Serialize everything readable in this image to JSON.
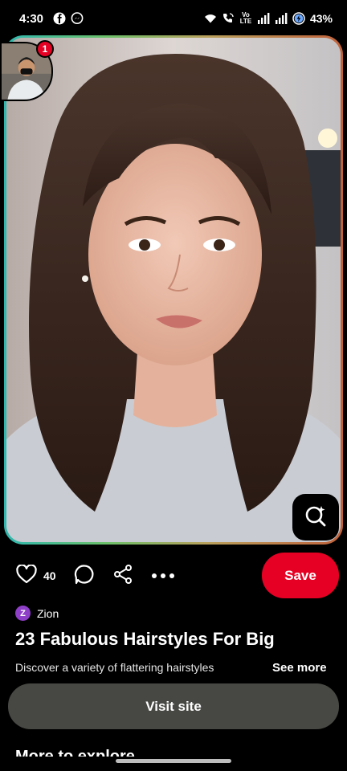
{
  "status_bar": {
    "time": "4:30",
    "left_icons": [
      "facebook-icon",
      "messenger-icon"
    ],
    "right_icons": [
      "wifi-icon",
      "wifi-call-icon",
      "volte-icon",
      "signal-icon",
      "signal-icon",
      "battery-saver-icon"
    ],
    "volte_label": "Vo\nLTE",
    "battery": "43%"
  },
  "profile": {
    "notification_count": "1"
  },
  "pin": {
    "like_count": "40",
    "save_label": "Save",
    "creator_initial": "Z",
    "creator_name": "Zion",
    "title": "23 Fabulous Hairstyles For Big",
    "description": "Discover a variety of flattering hairstyles",
    "see_more_label": "See more",
    "visit_label": "Visit site",
    "more_heading": "More to explore"
  },
  "colors": {
    "save": "#e60023",
    "visit": "#474743",
    "creator_badge": "#8e3fc7",
    "background": "#000000"
  }
}
